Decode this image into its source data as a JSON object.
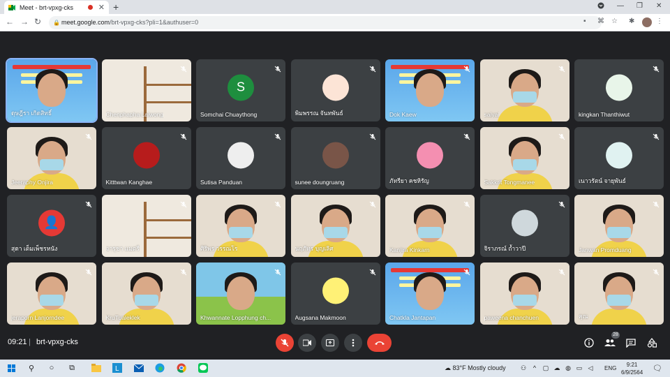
{
  "browser": {
    "tab_title": "Meet - brt-vpxg-cks",
    "tab_close": "✕",
    "new_tab": "+",
    "url_host": "meet.google.com",
    "url_path": "/brt-vpxg-cks?pli=1&authuser=0",
    "win_min": "—",
    "win_max": "❐",
    "win_close": "✕"
  },
  "colors": {
    "meet_bg": "#202124",
    "tile_bg": "#3c4043",
    "hangup_red": "#ea4335",
    "taskbar_bg": "#dfe6ee"
  },
  "participants": [
    {
      "name": "ดุษฎีรา เกิดสิทธิ์",
      "kind": "banner",
      "speaking": true
    },
    {
      "name": "Chenphapha Laiwong",
      "kind": "shelf"
    },
    {
      "name": "Somchai Chuaythong",
      "kind": "avatar",
      "initial": "S",
      "color": "#1e8e3e"
    },
    {
      "name": "พิมพรรณ จันทพันธ์",
      "kind": "avatar",
      "initial": "",
      "color": "#fce4d6"
    },
    {
      "name": "Dok Kaew",
      "kind": "banner"
    },
    {
      "name": "saiyai",
      "kind": "face"
    },
    {
      "name": "kingkan Thanthiwut",
      "kind": "avatar",
      "initial": "",
      "color": "#e8f5e9"
    },
    {
      "name": "Jeeraphy Onjira",
      "kind": "face"
    },
    {
      "name": "Kitttwan Kanghae",
      "kind": "avatar",
      "initial": "",
      "color": "#b71c1c"
    },
    {
      "name": "Sutisa Panduan",
      "kind": "avatar",
      "initial": "",
      "color": "#eeeeee"
    },
    {
      "name": "sunee doungruang",
      "kind": "avatar",
      "initial": "",
      "color": "#795548"
    },
    {
      "name": "ภัทรียา คชหิรัญ",
      "kind": "avatar",
      "initial": "",
      "color": "#f48fb1"
    },
    {
      "name": "Sakkrit Tongmanee",
      "kind": "face"
    },
    {
      "name": "เนาวรัตน์ จายุพันธ์",
      "kind": "avatar",
      "initial": "",
      "color": "#e0f2f1"
    },
    {
      "name": "สุดา เต็มเพ็ชรหนัง",
      "kind": "avatar",
      "initial": "👤",
      "color": "#e53935"
    },
    {
      "name": "จารุชา แมตรี",
      "kind": "shelf"
    },
    {
      "name": "ศิริพร วรรณโร",
      "kind": "face"
    },
    {
      "name": "นฤภัทร บุญเลิศ",
      "kind": "face"
    },
    {
      "name": "Kanjira Kinkarn",
      "kind": "face"
    },
    {
      "name": "จิราภรณ์ ถ้ำวาปี",
      "kind": "avatar",
      "initial": "",
      "color": "#cfd8dc"
    },
    {
      "name": "Janwan Promduang",
      "kind": "face"
    },
    {
      "name": "jeraporn Lanjorndee",
      "kind": "face"
    },
    {
      "name": "KruTualeklek",
      "kind": "face"
    },
    {
      "name": "Khwannate Lopphung ch...",
      "kind": "cartoon"
    },
    {
      "name": "Augsana Makmoon",
      "kind": "avatar",
      "initial": "",
      "color": "#fff176"
    },
    {
      "name": "Chatkla Jantapan",
      "kind": "banner"
    },
    {
      "name": "paweena chanchuen",
      "kind": "face"
    },
    {
      "name": "คุณ",
      "kind": "face"
    }
  ],
  "controls": {
    "time": "09:21",
    "separator": "|",
    "meeting_code": "brt-vpxg-cks",
    "participant_count": "28"
  },
  "taskbar": {
    "weather": "83°F  Mostly cloudy",
    "lang": "ENG",
    "time": "9:21",
    "date": "6/9/2564"
  }
}
